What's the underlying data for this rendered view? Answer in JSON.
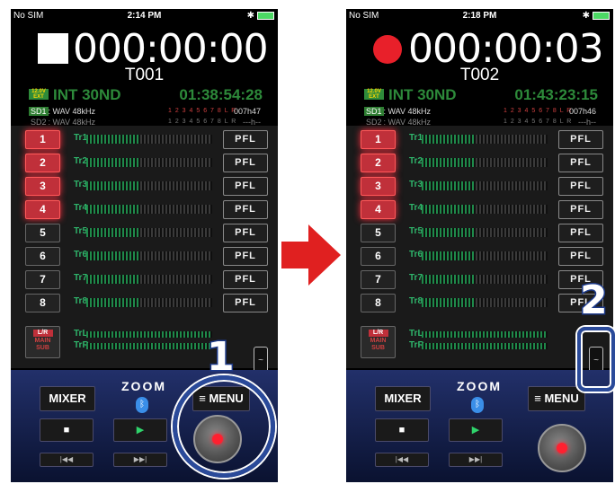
{
  "arrow_color": "#e02020",
  "callouts": [
    "1",
    "2"
  ],
  "screens": [
    {
      "status_bar": {
        "carrier": "No SIM",
        "time": "2:14 PM"
      },
      "recorder": {
        "state": "stop",
        "counter": "000:00:00",
        "take": "T001",
        "battery_label": "12.0V EXT",
        "rec_mode": "INT 30ND",
        "remaining_time": "01:38:54:28",
        "sd1": {
          "label": "SD1",
          "format": ": WAV 48kHz",
          "tracks": "1 2 3 4 5 6 7 8 L R",
          "remaining": "007h47"
        },
        "sd2": {
          "label": "SD2",
          "format": ": WAV 48kHz",
          "tracks": "1 2 3 4 5 6 7 8 L R",
          "remaining": "---h--"
        }
      },
      "tracks": [
        {
          "number": "1",
          "label": "Tr1",
          "armed": true,
          "pfl": "PFL"
        },
        {
          "number": "2",
          "label": "Tr2",
          "armed": true,
          "pfl": "PFL"
        },
        {
          "number": "3",
          "label": "Tr3",
          "armed": true,
          "pfl": "PFL"
        },
        {
          "number": "4",
          "label": "Tr4",
          "armed": true,
          "pfl": "PFL"
        },
        {
          "number": "5",
          "label": "Tr5",
          "armed": false,
          "pfl": "PFL"
        },
        {
          "number": "6",
          "label": "Tr6",
          "armed": false,
          "pfl": "PFL"
        },
        {
          "number": "7",
          "label": "Tr7",
          "armed": false,
          "pfl": "PFL"
        },
        {
          "number": "8",
          "label": "Tr8",
          "armed": false,
          "pfl": "PFL"
        }
      ],
      "main": {
        "top": "L/R",
        "mid": "MAIN",
        "bottom": "SUB",
        "left_label": "TrL",
        "right_label": "TrR"
      },
      "tab_icon": "wave-icon",
      "controls": {
        "mixer": "MIXER",
        "menu": "≡ MENU",
        "logo": "ZOOM",
        "bluetooth": "bluetooth-icon",
        "stop": "■",
        "play": "▶",
        "rewind": "|◀◀",
        "fast_forward": "▶▶|"
      }
    },
    {
      "status_bar": {
        "carrier": "No SIM",
        "time": "2:18 PM"
      },
      "recorder": {
        "state": "rec",
        "counter": "000:00:03",
        "take": "T002",
        "battery_label": "12.0V EXT",
        "rec_mode": "INT 30ND",
        "remaining_time": "01:43:23:15",
        "sd1": {
          "label": "SD1",
          "format": ": WAV 48kHz",
          "tracks": "1 2 3 4 5 6 7 8 L R",
          "remaining": "007h46"
        },
        "sd2": {
          "label": "SD2",
          "format": ": WAV 48kHz",
          "tracks": "1 2 3 4 5 6 7 8 L R",
          "remaining": "---h--"
        }
      },
      "tracks": [
        {
          "number": "1",
          "label": "Tr1",
          "armed": true,
          "pfl": "PFL"
        },
        {
          "number": "2",
          "label": "Tr2",
          "armed": true,
          "pfl": "PFL"
        },
        {
          "number": "3",
          "label": "Tr3",
          "armed": true,
          "pfl": "PFL"
        },
        {
          "number": "4",
          "label": "Tr4",
          "armed": true,
          "pfl": "PFL"
        },
        {
          "number": "5",
          "label": "Tr5",
          "armed": false,
          "pfl": "PFL"
        },
        {
          "number": "6",
          "label": "Tr6",
          "armed": false,
          "pfl": "PFL"
        },
        {
          "number": "7",
          "label": "Tr7",
          "armed": false,
          "pfl": "PFL"
        },
        {
          "number": "8",
          "label": "Tr8",
          "armed": false,
          "pfl": "PFL"
        }
      ],
      "main": {
        "top": "L/R",
        "mid": "MAIN",
        "bottom": "SUB",
        "left_label": "TrL",
        "right_label": "TrR"
      },
      "tab_icon": "wave-icon",
      "controls": {
        "mixer": "MIXER",
        "menu": "≡ MENU",
        "logo": "ZOOM",
        "bluetooth": "bluetooth-icon",
        "stop": "■",
        "play": "▶",
        "rewind": "|◀◀",
        "fast_forward": "▶▶|"
      }
    }
  ]
}
